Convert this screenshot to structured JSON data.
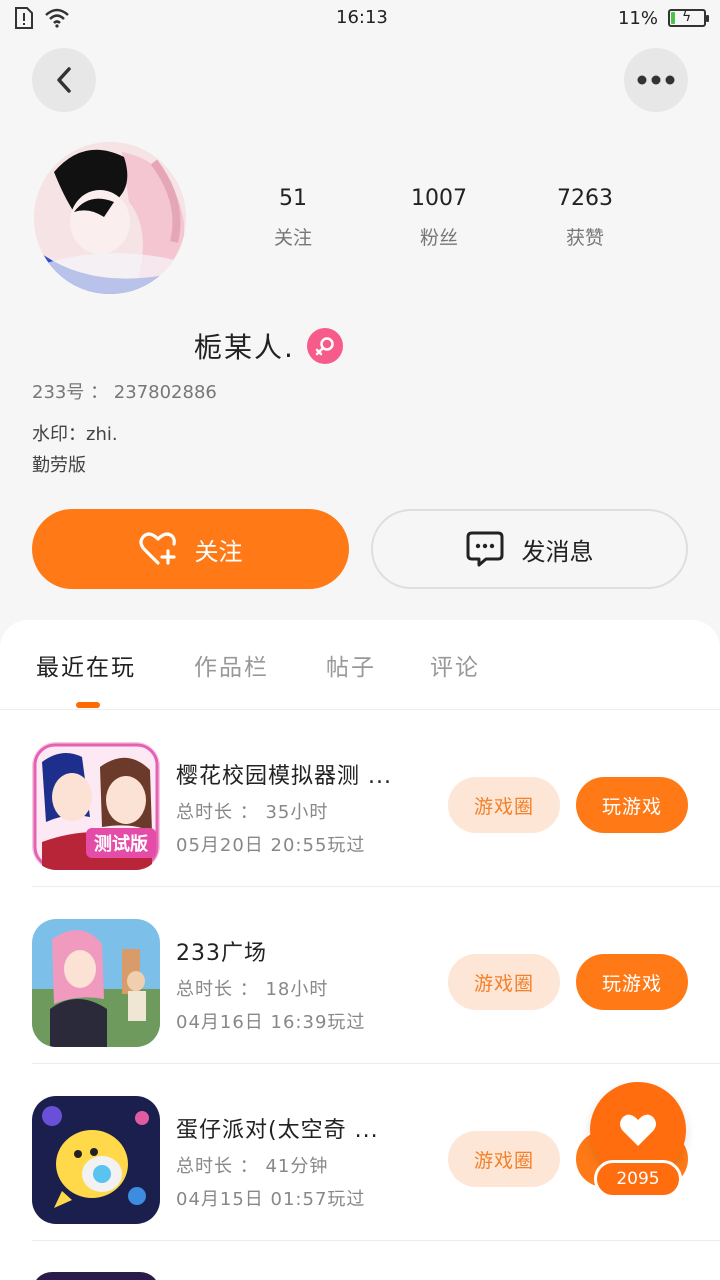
{
  "status_bar": {
    "time": "16:13",
    "battery_percent": "11%",
    "battery_level": 0.11
  },
  "nav": {
    "back_icon": "back-arrow-icon",
    "more_icon": "more-dots-icon"
  },
  "profile": {
    "stats": [
      {
        "value": "51",
        "label": "关注"
      },
      {
        "value": "1007",
        "label": "粉丝"
      },
      {
        "value": "7263",
        "label": "获赞"
      }
    ],
    "username": "栀某人.",
    "gender_icon": "female-icon",
    "id_line": "233号 ： 237802886",
    "bio_line1": "水印：zhi.",
    "bio_line2": "勤劳版"
  },
  "actions": {
    "follow_label": "关注",
    "message_label": "发消息"
  },
  "tabs": [
    {
      "label": "最近在玩",
      "active": true
    },
    {
      "label": "作品栏",
      "active": false
    },
    {
      "label": "帖子",
      "active": false
    },
    {
      "label": "评论",
      "active": false
    }
  ],
  "games": [
    {
      "title": "樱花校园模拟器测 ...",
      "duration": "总时长 ： 35小时",
      "last_played": "05月20日 20:55玩过",
      "circle_label": "游戏圈",
      "play_label": "玩游戏",
      "badge": "测试版"
    },
    {
      "title": "233广场",
      "duration": "总时长 ： 18小时",
      "last_played": "04月16日 16:39玩过",
      "circle_label": "游戏圈",
      "play_label": "玩游戏"
    },
    {
      "title": "蛋仔派对(太空奇 ...",
      "duration": "总时长 ： 41分钟",
      "last_played": "04月15日 01:57玩过",
      "circle_label": "游戏圈",
      "play_label": "玩游戏"
    }
  ],
  "like_float": {
    "count": "2095",
    "icon": "heart-icon"
  },
  "colors": {
    "accent": "#ff7a17",
    "circle_bg": "#fde6d6",
    "gender": "#f65b8a"
  }
}
